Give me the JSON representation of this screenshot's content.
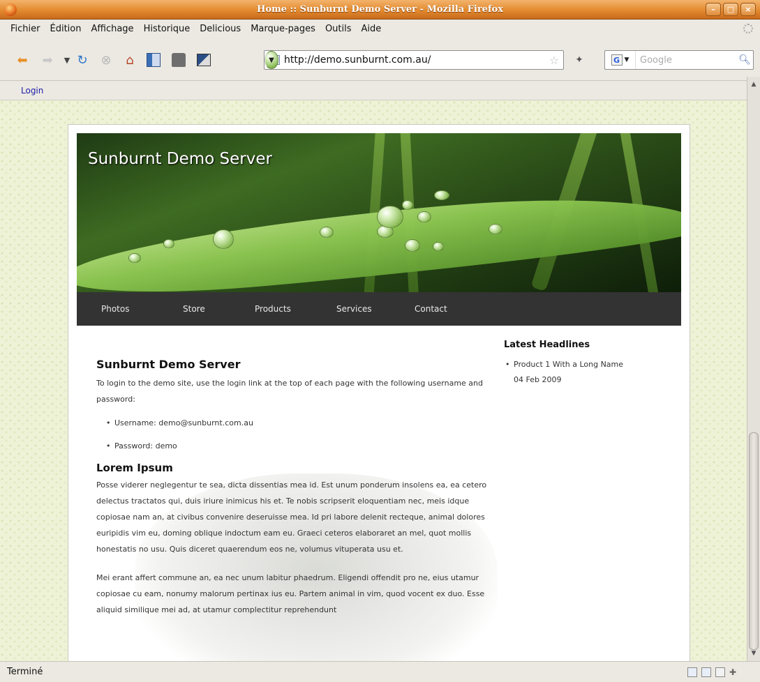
{
  "window": {
    "title": "Home :: Sunburnt Demo Server - Mozilla Firefox"
  },
  "menu": [
    "Fichier",
    "Édition",
    "Affichage",
    "Historique",
    "Delicious",
    "Marque-pages",
    "Outils",
    "Aide"
  ],
  "address_bar": {
    "url": "http://demo.sunburnt.com.au/"
  },
  "search_bar": {
    "engine_letter": "G",
    "placeholder": "Google"
  },
  "bookmarks": {
    "login": "Login"
  },
  "site": {
    "title": "Sunburnt Demo Server",
    "nav": [
      "Photos",
      "Store",
      "Products",
      "Services",
      "Contact"
    ],
    "main": {
      "heading": "Sunburnt Demo Server",
      "intro": "To login to the demo site, use the login link at the top of each page with the following username and password:",
      "credentials": [
        "Username: demo@sunburnt.com.au",
        "Password: demo"
      ],
      "subheading": "Lorem Ipsum",
      "para1": "Posse viderer neglegentur te sea, dicta dissentias mea id. Est unum ponderum insolens ea, ea cetero delectus tractatos qui, duis iriure inimicus his et. Te nobis scripserit eloquentiam nec, meis idque copiosae nam an, at civibus convenire deseruisse mea. Id pri labore delenit recteque, animal dolores euripidis vim eu, doming oblique indoctum eam eu. Graeci ceteros elaboraret an mel, quot mollis honestatis no usu. Quis diceret quaerendum eos ne, volumus vituperata usu et.",
      "para2": "Mei erant affert commune an, ea nec unum labitur phaedrum. Eligendi offendit pro ne, eius utamur copiosae cu eam, nonumy malorum pertinax ius eu. Partem animal in vim, quod vocent ex duo. Esse aliquid similique mei ad, at utamur complectitur reprehendunt"
    },
    "sidebar": {
      "heading": "Latest Headlines",
      "items": [
        {
          "title": "Product 1 With a Long Name",
          "date": "04 Feb 2009"
        }
      ]
    }
  },
  "status": {
    "text": "Terminé"
  },
  "colors": {
    "titlebar": "#e38a2f",
    "nav_bg": "#333333",
    "page_bg": "#eef2d6"
  }
}
